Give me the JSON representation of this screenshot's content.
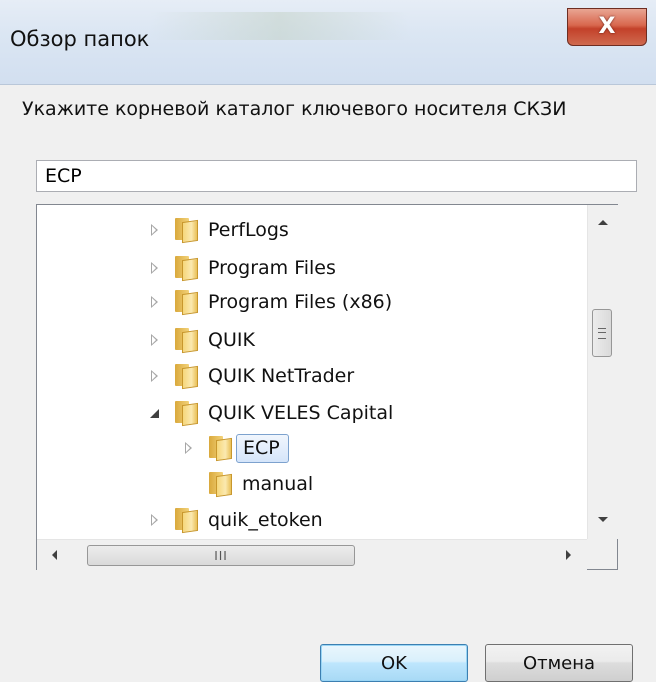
{
  "window": {
    "title": "Обзор папок",
    "close_glyph": "X"
  },
  "prompt": "Укажите корневой каталог ключевого носителя СКЗИ",
  "path_field": {
    "value": "ECP"
  },
  "tree": {
    "items": [
      {
        "label": "PerfLogs",
        "state": "collapsed"
      },
      {
        "label": "Program Files",
        "state": "collapsed"
      },
      {
        "label": "Program Files (x86)",
        "state": "collapsed"
      },
      {
        "label": "QUIK",
        "state": "collapsed"
      },
      {
        "label": "QUIK NetTrader",
        "state": "collapsed"
      },
      {
        "label": "QUIK VELES Capital",
        "state": "expanded"
      },
      {
        "label": "ECP",
        "state": "collapsed",
        "selected": true
      },
      {
        "label": "manual",
        "state": "none"
      },
      {
        "label": "quik_etoken",
        "state": "collapsed"
      }
    ]
  },
  "scrollbar": {
    "hthumb_grip": "III",
    "vertical_position": 0.45
  },
  "buttons": {
    "ok": "OK",
    "cancel": "Отмена"
  },
  "colors": {
    "selection_border": "#7da2ce",
    "default_button_border": "#3c7fb1",
    "close_button": "#c3412a"
  }
}
